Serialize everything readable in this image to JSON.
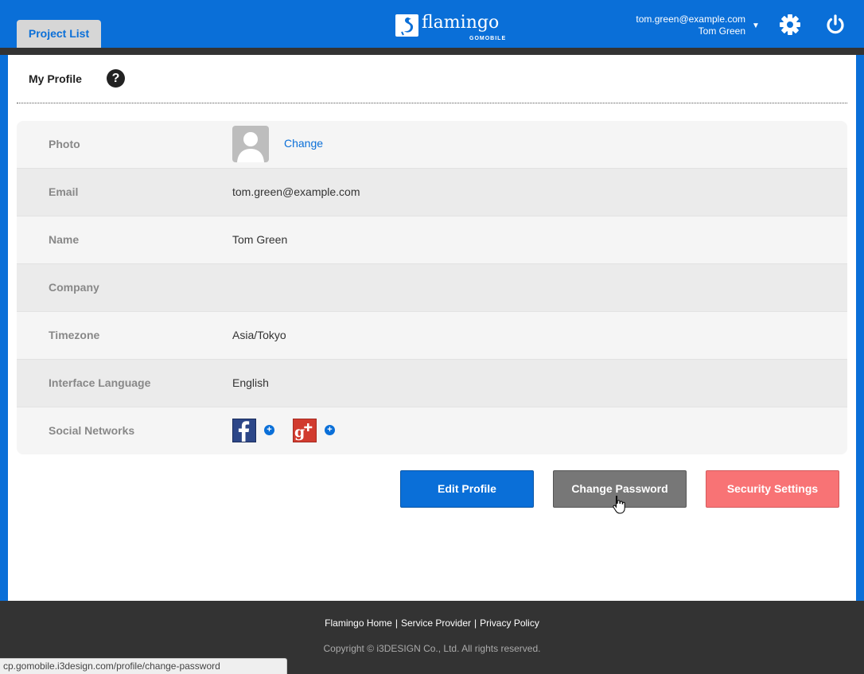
{
  "header": {
    "tab_label": "Project List",
    "logo_text": "flamingo",
    "logo_sub": "GOMOBILE",
    "user_email": "tom.green@example.com",
    "user_name": "Tom Green",
    "caret": "▼"
  },
  "page": {
    "title": "My Profile",
    "help": "?"
  },
  "profile": {
    "photo_label": "Photo",
    "photo_change": "Change",
    "rows": [
      {
        "label": "Email",
        "value": "tom.green@example.com"
      },
      {
        "label": "Name",
        "value": "Tom Green"
      },
      {
        "label": "Company",
        "value": ""
      },
      {
        "label": "Timezone",
        "value": "Asia/Tokyo"
      },
      {
        "label": "Interface Language",
        "value": "English"
      }
    ],
    "social_label": "Social Networks",
    "social": [
      {
        "name": "facebook",
        "icon": "facebook-icon"
      },
      {
        "name": "google-plus",
        "icon": "google-plus-icon"
      }
    ]
  },
  "buttons": {
    "edit": "Edit Profile",
    "password": "Change Password",
    "security": "Security Settings"
  },
  "footer": {
    "links": [
      "Flamingo Home",
      "Service Provider",
      "Privacy Policy"
    ],
    "copyright": "Copyright © i3DESIGN Co., Ltd. All rights reserved."
  },
  "status_bar": {
    "url": "cp.gomobile.i3design.com/profile/change-password"
  },
  "colors": {
    "brand_blue": "#0a6fd8",
    "gray_button": "#777777",
    "security_button": "#f87375"
  }
}
